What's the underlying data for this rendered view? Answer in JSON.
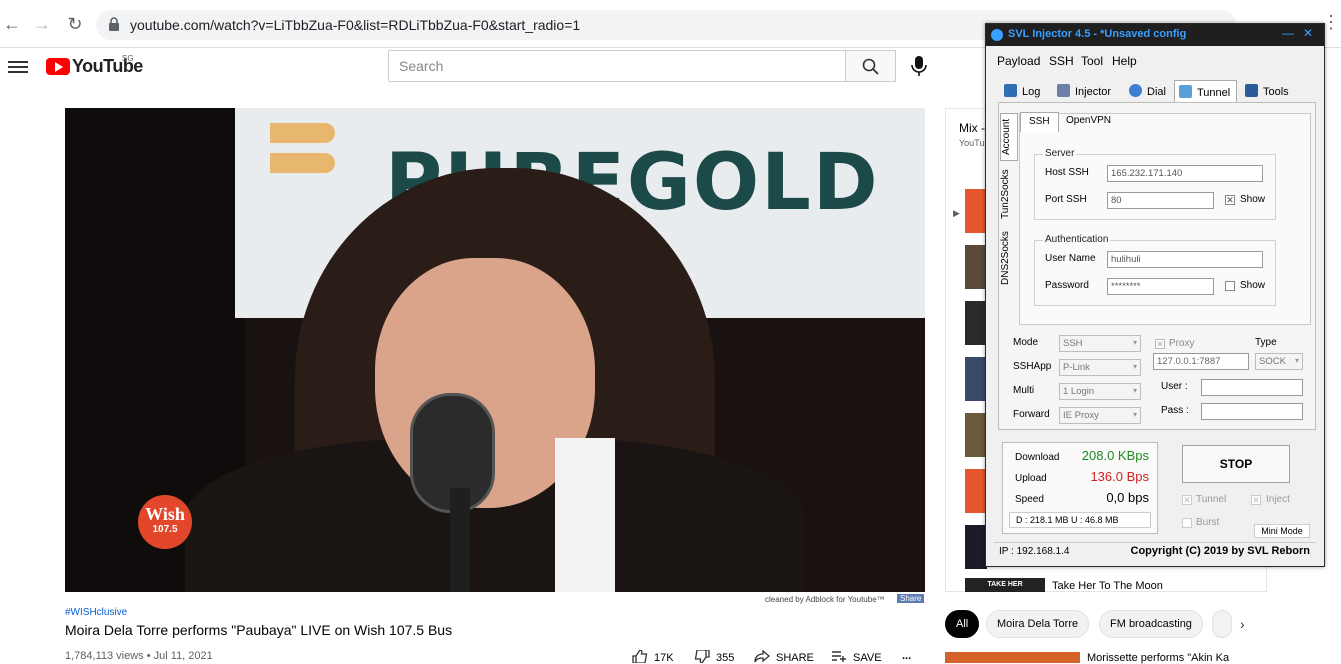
{
  "browser": {
    "url": "youtube.com/watch?v=LiTbbZua-F0&list=RDLiTbbZua-F0&start_radio=1"
  },
  "youtube": {
    "wordmark": "YouTube",
    "region": "SG",
    "search_placeholder": "Search",
    "video": {
      "banner_text": "PUREGOLD",
      "logo_text": "Wish",
      "logo_sub": "107.5",
      "adblock_note": "cleaned by Adblock for Youtube™",
      "adblock_share": "Share"
    },
    "hashtag": "#WISHclusive",
    "title": "Moira Dela Torre performs \"Paubaya\" LIVE on Wish 107.5 Bus",
    "meta": "1,784,113 views • Jul 11, 2021",
    "actions": {
      "likes": "17K",
      "dislikes": "355",
      "share": "SHARE",
      "save": "SAVE",
      "more": "..."
    },
    "mix": {
      "title": "Mix -",
      "subtitle": "YouTu",
      "last_item_title": "Take Her To The Moon",
      "last_item_thumb": "TAKE HER"
    },
    "chips": [
      "All",
      "Moira Dela Torre",
      "FM broadcasting"
    ],
    "next_video_title": "Morissette performs \"Akin Ka"
  },
  "injector": {
    "title": "SVL Injector 4.5 - *Unsaved config",
    "min": "—",
    "close": "✕",
    "menu": [
      "Payload",
      "SSH",
      "Tool",
      "Help"
    ],
    "tabs": [
      "Log",
      "Injector",
      "Dial",
      "Tunnel",
      "Tools"
    ],
    "vtabs": [
      "Account",
      "Tun2Socks",
      "DNS2Socks"
    ],
    "subtabs": [
      "SSH",
      "OpenVPN"
    ],
    "server": {
      "group": "Server",
      "host_label": "Host SSH",
      "host_value": "165.232.171.140",
      "port_label": "Port SSH",
      "port_value": "80",
      "show": "Show"
    },
    "auth": {
      "group": "Authentication",
      "user_label": "User Name",
      "user_value": "hulihuli",
      "pass_label": "Password",
      "pass_value": "********",
      "show": "Show"
    },
    "settings": {
      "mode_label": "Mode",
      "mode_value": "SSH",
      "sshapp_label": "SSHApp",
      "sshapp_value": "P-Link",
      "multi_label": "Multi",
      "multi_value": "1 Login",
      "forward_label": "Forward",
      "forward_value": "IE Proxy",
      "proxy_label": "Proxy",
      "proxy_value": "127.0.0.1:7887",
      "type_label": "Type",
      "type_value": "SOCK",
      "user_label": "User :",
      "pass_label": "Pass :"
    },
    "stats": {
      "download_label": "Download",
      "download_value": "208.0 KBps",
      "upload_label": "Upload",
      "upload_value": "136.0 Bps",
      "speed_label": "Speed",
      "speed_value": "0,0 bps",
      "du": "D :  218.1 MB     U :  46.8 MB"
    },
    "stop": "STOP",
    "tunnel_chk": "Tunnel",
    "inject_chk": "Inject",
    "burst_chk": "Burst",
    "mini_mode": "Mini Mode",
    "ip": "IP : 192.168.1.4",
    "copyright": "Copyright (C) 2019 by SVL Reborn",
    "colors": {
      "title_accent": "#3aa0ff",
      "download": "#1f8a1f",
      "upload": "#d42020"
    }
  }
}
